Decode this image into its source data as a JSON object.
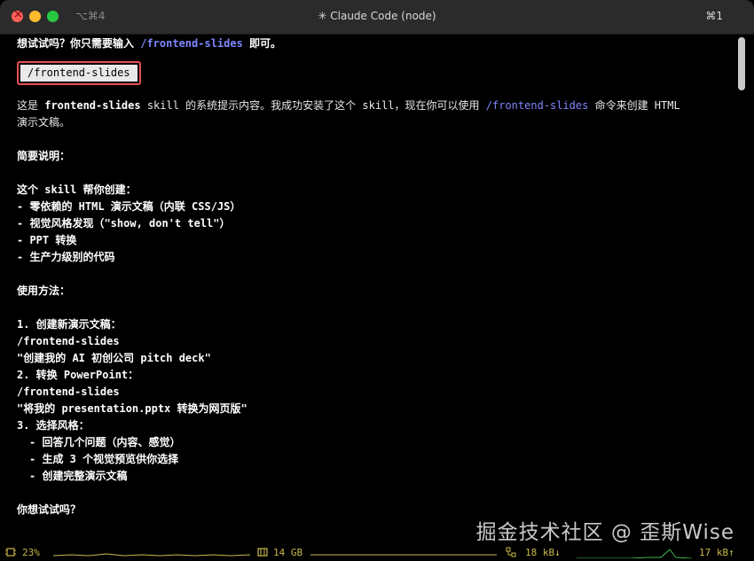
{
  "window": {
    "title": "✳ Claude Code (node)",
    "shortcut_left": "⌥⌘4",
    "shortcut_right": "⌘1"
  },
  "terminal": {
    "line1_prefix": "想试试吗？你只需要输入 ",
    "line1_cmd": "/frontend-slides",
    "line1_suffix": " 即可。",
    "highlight_cmd": "/frontend-slides",
    "para1_a": "这是 ",
    "para1_bold": "frontend-slides",
    "para1_b": " skill 的系统提示内容。我成功安装了这个 skill，现在你可以使用 ",
    "para1_cmd": "/frontend-slides",
    "para1_c": " 命令来创建 HTML",
    "para1_line2": "演示文稿。",
    "summary_heading": "简要说明：",
    "skill_intro": "这个 skill 帮你创建：",
    "features": [
      "- 零依赖的 HTML 演示文稿（内联 CSS/JS）",
      "- 视觉风格发现（\"show, don't tell\"）",
      "- PPT 转换",
      "- 生产力级别的代码"
    ],
    "usage_heading": "使用方法：",
    "step1_title": "1. 创建新演示文稿：",
    "step1_cmd": "/frontend-slides",
    "step1_example": "\"创建我的 AI 初创公司 pitch deck\"",
    "step2_title": "2. 转换 PowerPoint：",
    "step2_cmd": "/frontend-slides",
    "step2_example": "\"将我的 presentation.pptx 转换为网页版\"",
    "step3_title": "3. 选择风格：",
    "step3_items": [
      "- 回答几个问题（内容、感觉）",
      "- 生成 3 个视觉预览供你选择",
      "- 创建完整演示文稿"
    ],
    "closing": "你想试试吗？"
  },
  "status_bar": {
    "cpu": "23%",
    "memory": "14 GB",
    "net_down": "18 kB↓",
    "net_up": "17 kB↑"
  },
  "watermark": "掘金技术社区 @ 歪斯Wise",
  "colors": {
    "command_blue": "#7f86ff",
    "highlight_border": "#e55050",
    "status_yellow": "#c8b848",
    "status_green": "#3fb950"
  }
}
